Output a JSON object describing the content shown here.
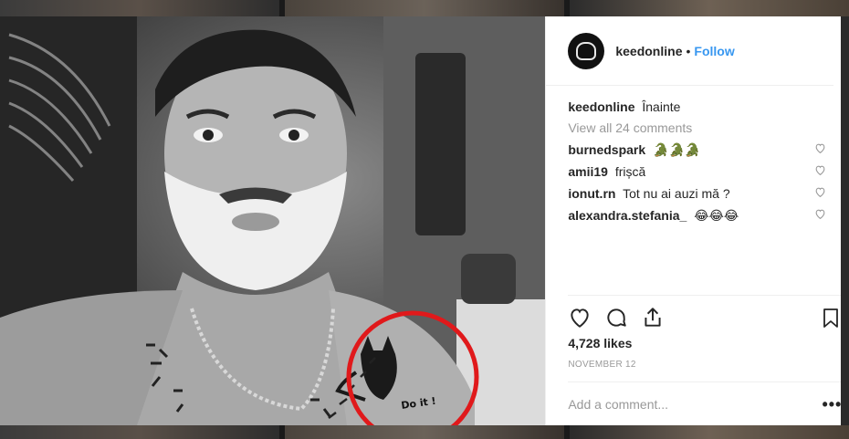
{
  "post": {
    "username": "keedonline",
    "separator": "•",
    "follow_label": "Follow",
    "caption_user": "keedonline",
    "caption_text": "Înainte",
    "view_all_prefix": "View all",
    "view_all_count": "24 comments",
    "likes": "4,728 likes",
    "date": "NOVEMBER 12",
    "add_comment_placeholder": "Add a comment...",
    "more_label": "•••"
  },
  "comments": [
    {
      "user": "burnedspark",
      "text": "🐊🐊🐊"
    },
    {
      "user": "amii19",
      "text": "frișcă"
    },
    {
      "user": "ionut.rn",
      "text": "Tot nu ai auzi mă ?"
    },
    {
      "user": "alexandra.stefania_",
      "text": "😂😂😂"
    }
  ],
  "photo": {
    "tattoo_text": "Do it !"
  },
  "colors": {
    "accent": "#3897f0",
    "annotation_circle": "#e0191b"
  },
  "icons": [
    "heart-icon",
    "comment-icon",
    "share-icon",
    "bookmark-icon"
  ]
}
